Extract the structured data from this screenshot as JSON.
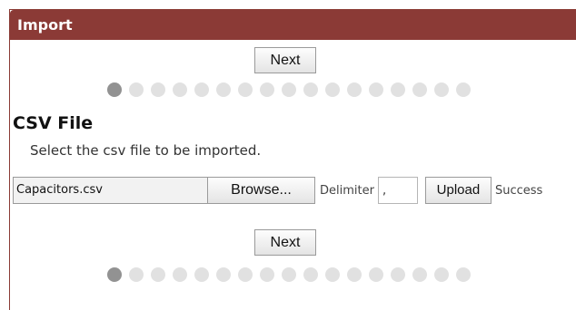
{
  "header": {
    "title": "Import"
  },
  "navigation": {
    "next_label": "Next",
    "total_steps": 17,
    "current_step": 1
  },
  "section": {
    "title": "CSV File",
    "description": "Select the csv file to be imported."
  },
  "file_input": {
    "file_name": "Capacitors.csv",
    "browse_label": "Browse..."
  },
  "delimiter": {
    "label": "Delimiter",
    "value": ","
  },
  "upload": {
    "label": "Upload",
    "status": "Success"
  },
  "colors": {
    "header_bg": "#8b3a36",
    "dot_active": "#929292",
    "dot_inactive": "#e1e1e1"
  }
}
